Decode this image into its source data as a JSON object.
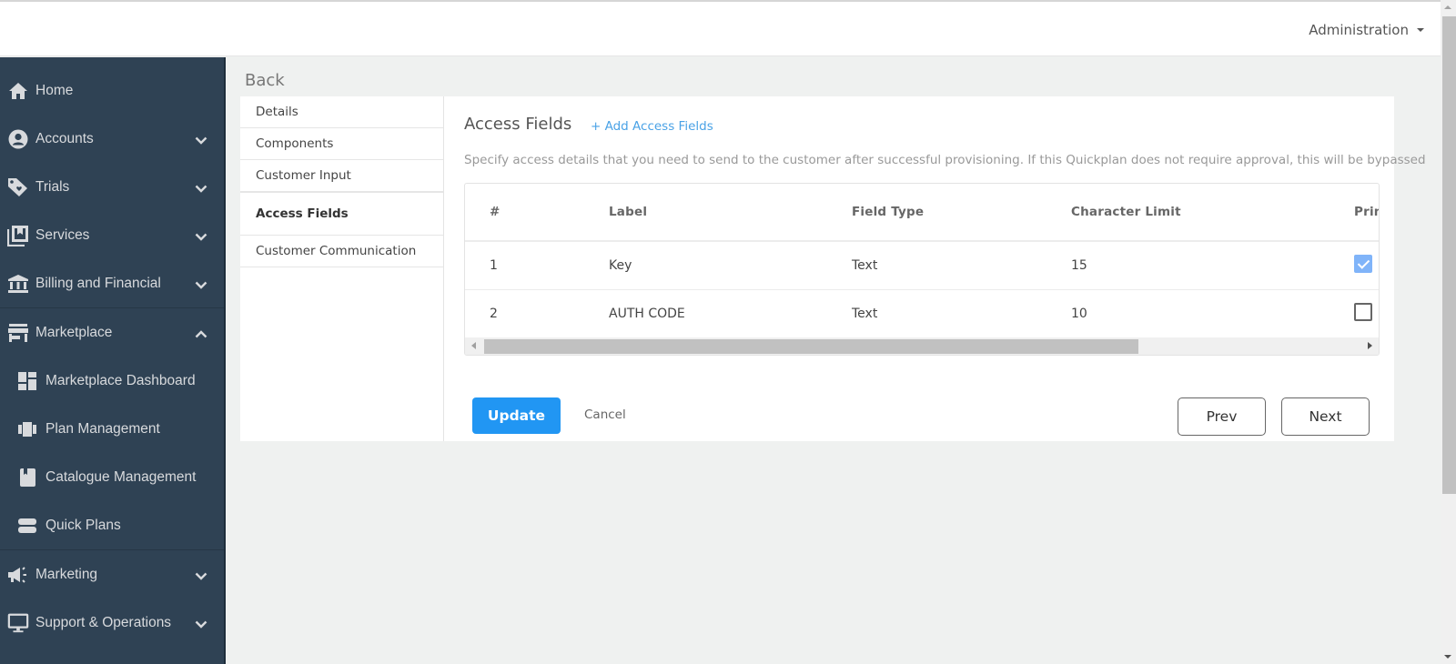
{
  "header": {
    "admin_menu_label": "Administration",
    "admin_menu_icon": "caret-down-icon"
  },
  "sidebar": {
    "items": [
      {
        "label": "Home",
        "icon": "home-icon",
        "expandable": false
      },
      {
        "label": "Accounts",
        "icon": "user-circle-icon",
        "expandable": true,
        "expanded": false
      },
      {
        "label": "Trials",
        "icon": "tag-heart-icon",
        "expandable": true,
        "expanded": false
      },
      {
        "label": "Services",
        "icon": "services-icon",
        "expandable": true,
        "expanded": false
      },
      {
        "label": "Billing and Financial",
        "icon": "bank-icon",
        "expandable": true,
        "expanded": false
      },
      {
        "label": "Marketplace",
        "icon": "store-icon",
        "expandable": true,
        "expanded": true,
        "children": [
          {
            "label": "Marketplace Dashboard",
            "icon": "dashboard-icon"
          },
          {
            "label": "Plan Management",
            "icon": "plan-icon"
          },
          {
            "label": "Catalogue Management",
            "icon": "book-icon"
          },
          {
            "label": "Quick Plans",
            "icon": "stack-icon"
          }
        ]
      },
      {
        "label": "Marketing",
        "icon": "megaphone-icon",
        "expandable": true,
        "expanded": false
      },
      {
        "label": "Support & Operations",
        "icon": "monitor-icon",
        "expandable": true,
        "expanded": false
      }
    ]
  },
  "main": {
    "back_label": "Back",
    "steps": [
      {
        "label": "Details",
        "active": false
      },
      {
        "label": "Components",
        "active": false
      },
      {
        "label": "Customer Input",
        "active": false
      },
      {
        "label": "Access Fields",
        "active": true
      },
      {
        "label": "Customer Communication",
        "active": false
      }
    ],
    "section_title": "Access Fields",
    "add_link": "+ Add Access Fields",
    "description": "Specify access details that you need to send to the customer after successful provisioning. If this Quickplan does not require approval, this will be bypassed",
    "table": {
      "columns": [
        "#",
        "Label",
        "Field Type",
        "Character Limit",
        "Primary"
      ],
      "rows": [
        {
          "num": "1",
          "label": "Key",
          "field_type": "Text",
          "char_limit": "15",
          "primary": true
        },
        {
          "num": "2",
          "label": "AUTH CODE",
          "field_type": "Text",
          "char_limit": "10",
          "primary": false
        }
      ]
    },
    "buttons": {
      "update": "Update",
      "cancel": "Cancel",
      "prev": "Prev",
      "next": "Next"
    }
  },
  "colors": {
    "sidebar_bg": "#2f4254",
    "primary": "#2196f3",
    "link": "#4aa2e6",
    "checkbox_checked": "#80b4f9"
  }
}
